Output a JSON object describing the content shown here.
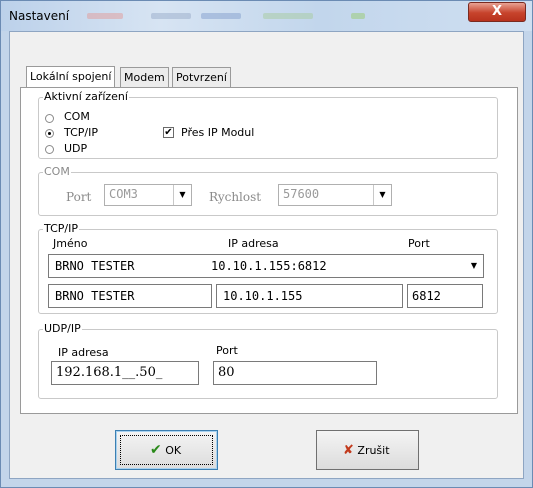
{
  "window": {
    "title": "Nastavení",
    "close_glyph": "X"
  },
  "tabs": [
    {
      "label": "Lokální spojení",
      "active": true
    },
    {
      "label": "Modem",
      "active": false
    },
    {
      "label": "Potvrzení",
      "active": false
    }
  ],
  "active_device": {
    "group_label": "Aktivní zařízení",
    "options": [
      {
        "label": "COM",
        "selected": false
      },
      {
        "label": "TCP/IP",
        "selected": true
      },
      {
        "label": "UDP",
        "selected": false
      }
    ],
    "ip_module": {
      "label": "Přes IP Modul",
      "checked": true,
      "check_glyph": "✔"
    }
  },
  "com": {
    "group_label": "COM",
    "port_label": "Port",
    "port_value": "COM3",
    "speed_label": "Rychlost",
    "speed_value": "57600",
    "arrow_glyph": "▼"
  },
  "tcpip": {
    "group_label": "TCP/IP",
    "name_header": "Jméno",
    "ip_header": "IP adresa",
    "port_header": "Port",
    "combo_name": "BRNO TESTER",
    "combo_address": "10.10.1.155:6812",
    "name_value": "BRNO TESTER",
    "ip_value": "10.10.1.155",
    "port_value": "6812"
  },
  "udpip": {
    "group_label": "UDP/IP",
    "ip_label": "IP adresa",
    "port_label": "Port",
    "ip_value": "192.168.1__.50_",
    "port_value": "80"
  },
  "buttons": {
    "ok_label": "OK",
    "ok_glyph": "✔",
    "cancel_label": "Zrušit",
    "cancel_glyph": "✘"
  },
  "colors": {
    "title_bar": "#c3d5ea",
    "close_button": "#c7432c",
    "ok_icon": "#2a8a1a",
    "cancel_icon": "#c23a1c"
  }
}
